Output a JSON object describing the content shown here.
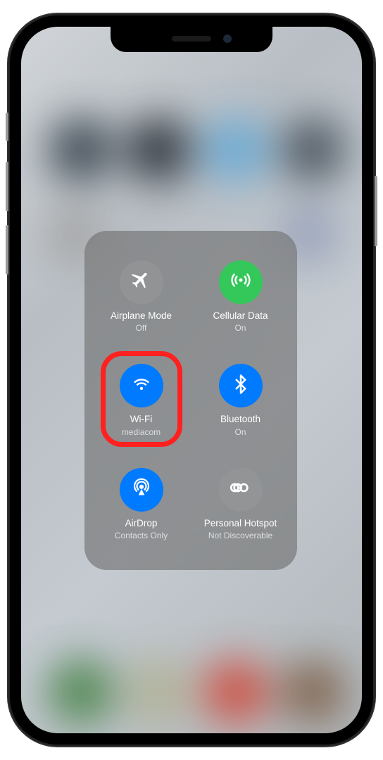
{
  "controls": {
    "airplane": {
      "label": "Airplane Mode",
      "status": "Off"
    },
    "cellular": {
      "label": "Cellular Data",
      "status": "On"
    },
    "wifi": {
      "label": "Wi-Fi",
      "status": "mediacom"
    },
    "bluetooth": {
      "label": "Bluetooth",
      "status": "On"
    },
    "airdrop": {
      "label": "AirDrop",
      "status": "Contacts Only"
    },
    "hotspot": {
      "label": "Personal Hotspot",
      "status": "Not Discoverable"
    }
  }
}
